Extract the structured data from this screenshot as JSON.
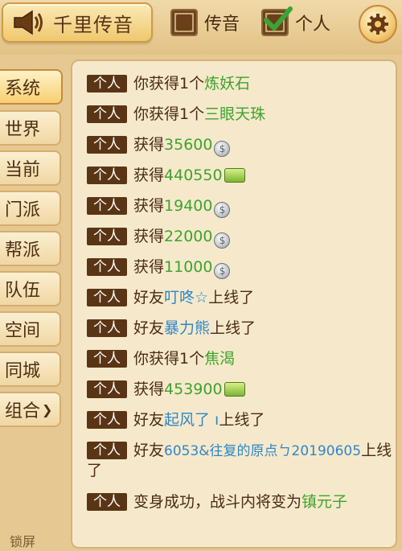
{
  "topbar": {
    "horn_label": "千里传音",
    "checkbox_chuanyin": {
      "label": "传音",
      "checked": false
    },
    "checkbox_geren": {
      "label": "个人",
      "checked": true
    }
  },
  "tabs": [
    {
      "label": "系统",
      "active": true
    },
    {
      "label": "世界",
      "active": false
    },
    {
      "label": "当前",
      "active": false
    },
    {
      "label": "门派",
      "active": false
    },
    {
      "label": "帮派",
      "active": false
    },
    {
      "label": "队伍",
      "active": false
    },
    {
      "label": "空间",
      "active": false
    },
    {
      "label": "同城",
      "active": false
    },
    {
      "label": "组合",
      "active": false,
      "arrow": "❯"
    }
  ],
  "lock_label": "锁屏",
  "messages": [
    {
      "tag": "个人",
      "text": "你获得1个",
      "highlight": "炼妖石"
    },
    {
      "tag": "个人",
      "text": "你获得1个",
      "highlight": "三眼天珠"
    },
    {
      "tag": "个人",
      "text": "获得",
      "amount": "35600",
      "icon": "coin-icon"
    },
    {
      "tag": "个人",
      "text": "获得",
      "amount": "440550",
      "icon": "exp-icon"
    },
    {
      "tag": "个人",
      "text": "获得",
      "amount": "19400",
      "icon": "coin-icon"
    },
    {
      "tag": "个人",
      "text": "获得",
      "amount": "22000",
      "icon": "coin-icon"
    },
    {
      "tag": "个人",
      "text": "获得",
      "amount": "11000",
      "icon": "coin-icon"
    },
    {
      "tag": "个人",
      "text": "好友",
      "friend": "叮咚☆",
      "suffix": "上线了"
    },
    {
      "tag": "个人",
      "text": "好友",
      "friend": "暴力熊",
      "suffix": "上线了"
    },
    {
      "tag": "个人",
      "text": "你获得1个",
      "highlight": "焦渴"
    },
    {
      "tag": "个人",
      "text": "获得",
      "amount": "453900",
      "icon": "exp-icon"
    },
    {
      "tag": "个人",
      "text": "好友",
      "friend": "起风了 ı",
      "suffix": "上线了"
    },
    {
      "tag": "个人",
      "text": "好友",
      "friend": "6053&往复的原点ㄅ20190605",
      "suffix": "上线了"
    },
    {
      "tag": "个人",
      "text": "变身成功，战斗内将变为",
      "highlight": "镇元子"
    }
  ],
  "colors": {
    "green": "#3ea32c",
    "blue": "#2f86c8",
    "tag_bg": "#5a3515"
  }
}
